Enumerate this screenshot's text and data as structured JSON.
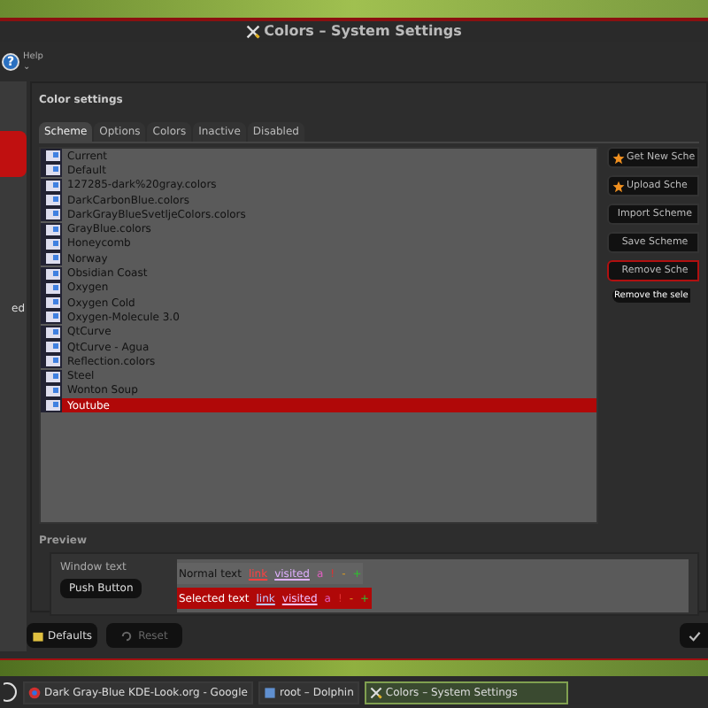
{
  "window": {
    "title": "Colors – System Settings"
  },
  "toolbar": {
    "help_glyph": "?",
    "help": "Help",
    "chevron": "⌄"
  },
  "sidebar": {
    "items": [
      {
        "selected": true
      },
      {
        "label": "ed",
        "selected": false
      }
    ]
  },
  "header": "Color settings",
  "tabs": [
    {
      "label": "Scheme",
      "selected": true
    },
    {
      "label": "Options",
      "selected": false
    },
    {
      "label": "Colors",
      "selected": false
    },
    {
      "label": "Inactive",
      "selected": false
    },
    {
      "label": "Disabled",
      "selected": false
    }
  ],
  "schemes": [
    {
      "name": "Current",
      "selected": false
    },
    {
      "name": "Default",
      "selected": false
    },
    {
      "name": "127285-dark%20gray.colors",
      "selected": false
    },
    {
      "name": "DarkCarbonBlue.colors",
      "selected": false
    },
    {
      "name": "DarkGrayBlueSvetljeColors.colors",
      "selected": false
    },
    {
      "name": "GrayBlue.colors",
      "selected": false
    },
    {
      "name": "Honeycomb",
      "selected": false
    },
    {
      "name": "Norway",
      "selected": false
    },
    {
      "name": "Obsidian Coast",
      "selected": false
    },
    {
      "name": "Oxygen",
      "selected": false
    },
    {
      "name": "Oxygen Cold",
      "selected": false
    },
    {
      "name": "Oxygen-Molecule 3.0",
      "selected": false
    },
    {
      "name": "QtCurve",
      "selected": false
    },
    {
      "name": "QtCurve - Agua",
      "selected": false
    },
    {
      "name": "Reflection.colors",
      "selected": false
    },
    {
      "name": "Steel",
      "selected": false
    },
    {
      "name": "Wonton Soup",
      "selected": false
    },
    {
      "name": "Youtube",
      "selected": true
    }
  ],
  "actions": [
    {
      "label": "Get New Sche",
      "kind": "star",
      "focused": false
    },
    {
      "label": "Upload Sche",
      "kind": "star",
      "focused": false
    },
    {
      "label": "Import Scheme",
      "kind": "plain",
      "focused": false
    },
    {
      "label": "Save Scheme",
      "kind": "plain",
      "focused": false
    },
    {
      "label": "Remove Sche",
      "kind": "plain",
      "focused": true
    }
  ],
  "tooltip": "Remove the sele",
  "preview": {
    "title": "Preview",
    "window_text": "Window text",
    "push_button": "Push Button",
    "rows": [
      {
        "text": "Normal text",
        "link": "link",
        "visited": "visited",
        "marks": [
          "a",
          "!",
          "-",
          "+"
        ],
        "selected": false
      },
      {
        "text": "Selected text",
        "link": "link",
        "visited": "visited",
        "marks": [
          "a",
          "!",
          "-",
          "+"
        ],
        "selected": true
      }
    ]
  },
  "footer": {
    "defaults": "Defaults",
    "reset": "Reset"
  },
  "taskbar": [
    {
      "label": "Dark Gray-Blue KDE-Look.org - Google",
      "kind": "browser",
      "active": false
    },
    {
      "label": "root – Dolphin",
      "kind": "files",
      "active": false
    },
    {
      "label": "Colors – System Settings",
      "kind": "settings",
      "active": true
    }
  ]
}
